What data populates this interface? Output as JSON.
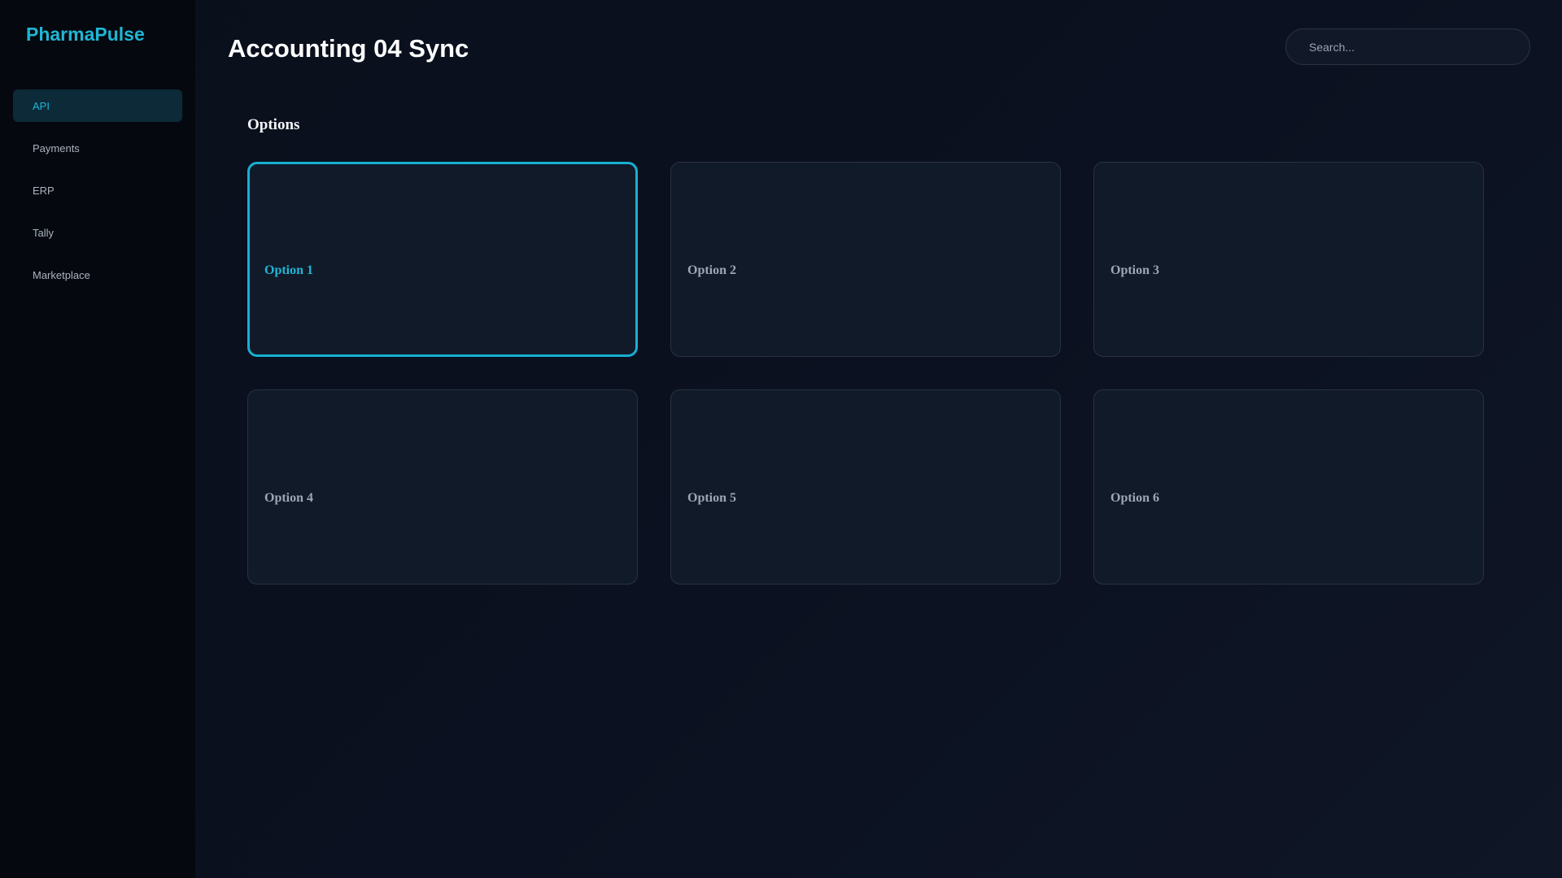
{
  "app": {
    "brand": "PharmaPulse"
  },
  "sidebar": {
    "items": [
      {
        "label": "API",
        "active": true
      },
      {
        "label": "Payments",
        "active": false
      },
      {
        "label": "ERP",
        "active": false
      },
      {
        "label": "Tally",
        "active": false
      },
      {
        "label": "Marketplace",
        "active": false
      }
    ]
  },
  "header": {
    "title": "Accounting 04 Sync",
    "search_placeholder": "Search..."
  },
  "options_section": {
    "title": "Options",
    "selected_index": 0,
    "options": [
      {
        "label": "Option 1"
      },
      {
        "label": "Option 2"
      },
      {
        "label": "Option 3"
      },
      {
        "label": "Option 4"
      },
      {
        "label": "Option 5"
      },
      {
        "label": "Option 6"
      }
    ]
  },
  "colors": {
    "accent": "#1fb6d5",
    "background": "#0b1120",
    "sidebar": "#05090f",
    "card": "#111a29"
  }
}
